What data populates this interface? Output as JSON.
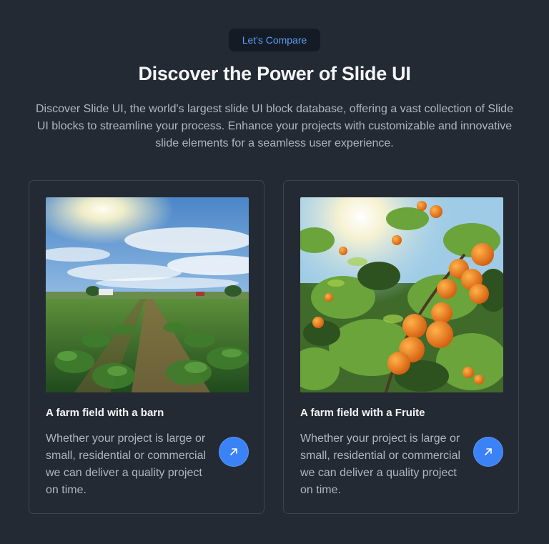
{
  "badge": "Let's Compare",
  "title": "Discover the Power of Slide UI",
  "description": "Discover Slide UI, the world's largest slide UI block database, offering a vast collection of Slide UI blocks to streamline your process. Enhance your projects with customizable and innovative slide elements for a seamless user experience.",
  "cards": [
    {
      "title": "A farm field with a barn",
      "text": "Whether your project is large or small, residential or commercial we can deliver a quality project on time.",
      "icon": "arrow-up-right-icon"
    },
    {
      "title": "A farm field with a Fruite",
      "text": "Whether your project is large or small, residential or commercial we can deliver a quality project on time.",
      "icon": "arrow-up-right-icon"
    }
  ],
  "colors": {
    "background": "#242a33",
    "accent": "#3b82f6",
    "badge_text": "#5b9cf7"
  }
}
